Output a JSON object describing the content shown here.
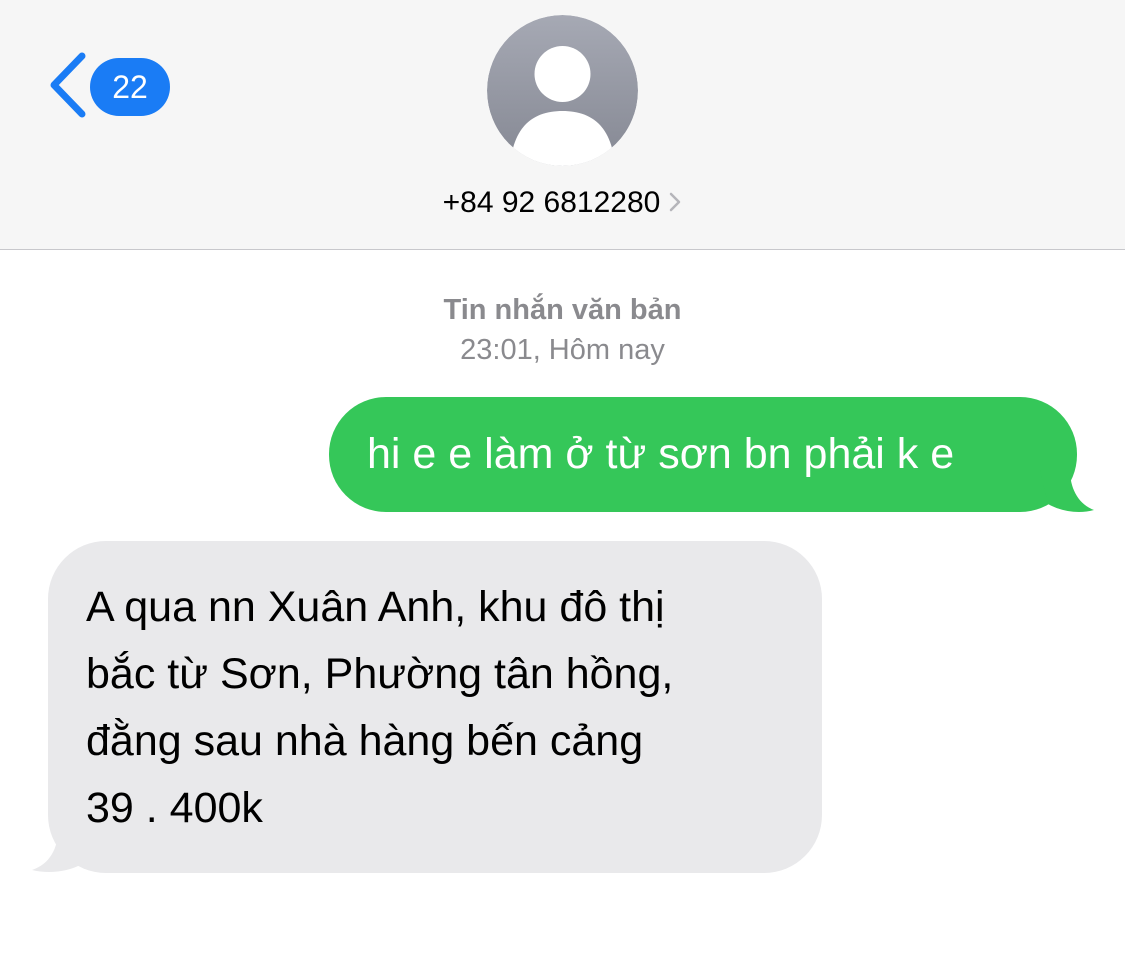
{
  "header": {
    "back_badge_count": "22",
    "contact_phone": "+84 92 6812280"
  },
  "conversation": {
    "timestamp_label": "Tin nhắn văn bản",
    "timestamp_time": "23:01, Hôm nay",
    "messages": [
      {
        "direction": "sent",
        "lines": [
          "hi e e làm ở từ sơn bn phải k e"
        ]
      },
      {
        "direction": "received",
        "lines": [
          "A qua nn Xuân Anh, khu đô thị",
          "bắc từ Sơn, Phường tân hồng,",
          "đằng sau nhà hàng bến cảng",
          "39 . 400k"
        ]
      }
    ]
  },
  "icons": {
    "back": "chevron-left-icon",
    "avatar": "person-icon",
    "contact_detail": "chevron-right-icon"
  },
  "colors": {
    "accent": "#1a7cf5",
    "sent_bubble": "#35c759",
    "received_bubble": "#e9e9eb",
    "header_bg": "#f6f6f6",
    "meta_text": "#8a8a8e"
  }
}
